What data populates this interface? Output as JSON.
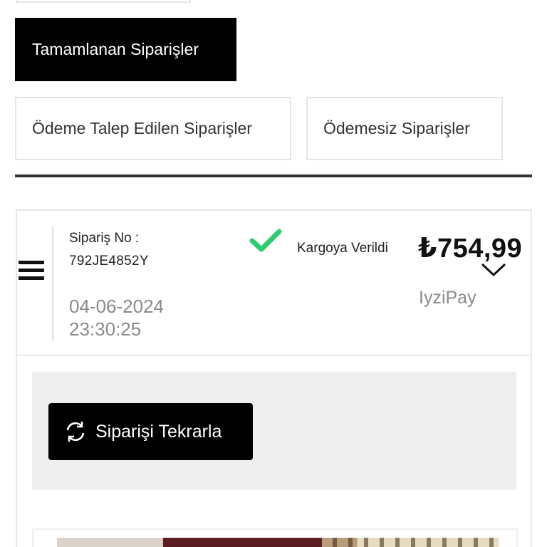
{
  "tabs": {
    "active": "Tamamlanan Siparişler",
    "payment_requested": "Ödeme Talep Edilen Siparişler",
    "unpaid": "Ödemesiz Siparişler"
  },
  "order": {
    "label": "Sipariş No :",
    "number": "792JE4852Y",
    "date": "04-06-2024",
    "time": "23:30:25",
    "status": "Kargoya Verildi",
    "status_color": "#2ecc71",
    "price": "₺754,99",
    "payment_method": "IyziPay"
  },
  "actions": {
    "repeat_label": "Siparişi Tekrarla"
  },
  "icons": {
    "menu": "hamburger-icon",
    "status": "check-icon",
    "expand": "chevron-down-icon",
    "repeat": "refresh-icon"
  },
  "colors": {
    "accent": "#000000",
    "muted_text": "#8a8a8a",
    "panel_bg": "#efefef"
  }
}
